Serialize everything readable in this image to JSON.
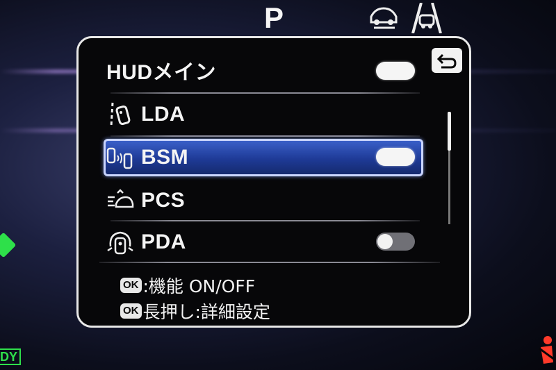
{
  "status": {
    "gear": "P",
    "left_indicator": "DY"
  },
  "menu": {
    "rows": [
      {
        "label": "HUDメイン",
        "icon": "none",
        "toggle": "on"
      },
      {
        "label": "LDA",
        "icon": "lane-departure-icon",
        "toggle": "none"
      },
      {
        "label": "BSM",
        "icon": "blind-spot-monitor-icon",
        "toggle": "on",
        "selected": true
      },
      {
        "label": "PCS",
        "icon": "pre-collision-icon",
        "toggle": "none"
      },
      {
        "label": "PDA",
        "icon": "proactive-driving-assist-icon",
        "toggle": "off"
      }
    ],
    "help": {
      "line1_badge": "OK",
      "line1_text": ":機能 ON/OFF",
      "line2_badge": "OK",
      "line2_text": "長押し:詳細設定"
    }
  },
  "colors": {
    "panel_border": "#e8e8e8",
    "selected_fill": "#1e3a96",
    "selected_border": "#c9d4ff",
    "ready_green": "#2fe04b",
    "warning_red": "#ff3a2a"
  }
}
